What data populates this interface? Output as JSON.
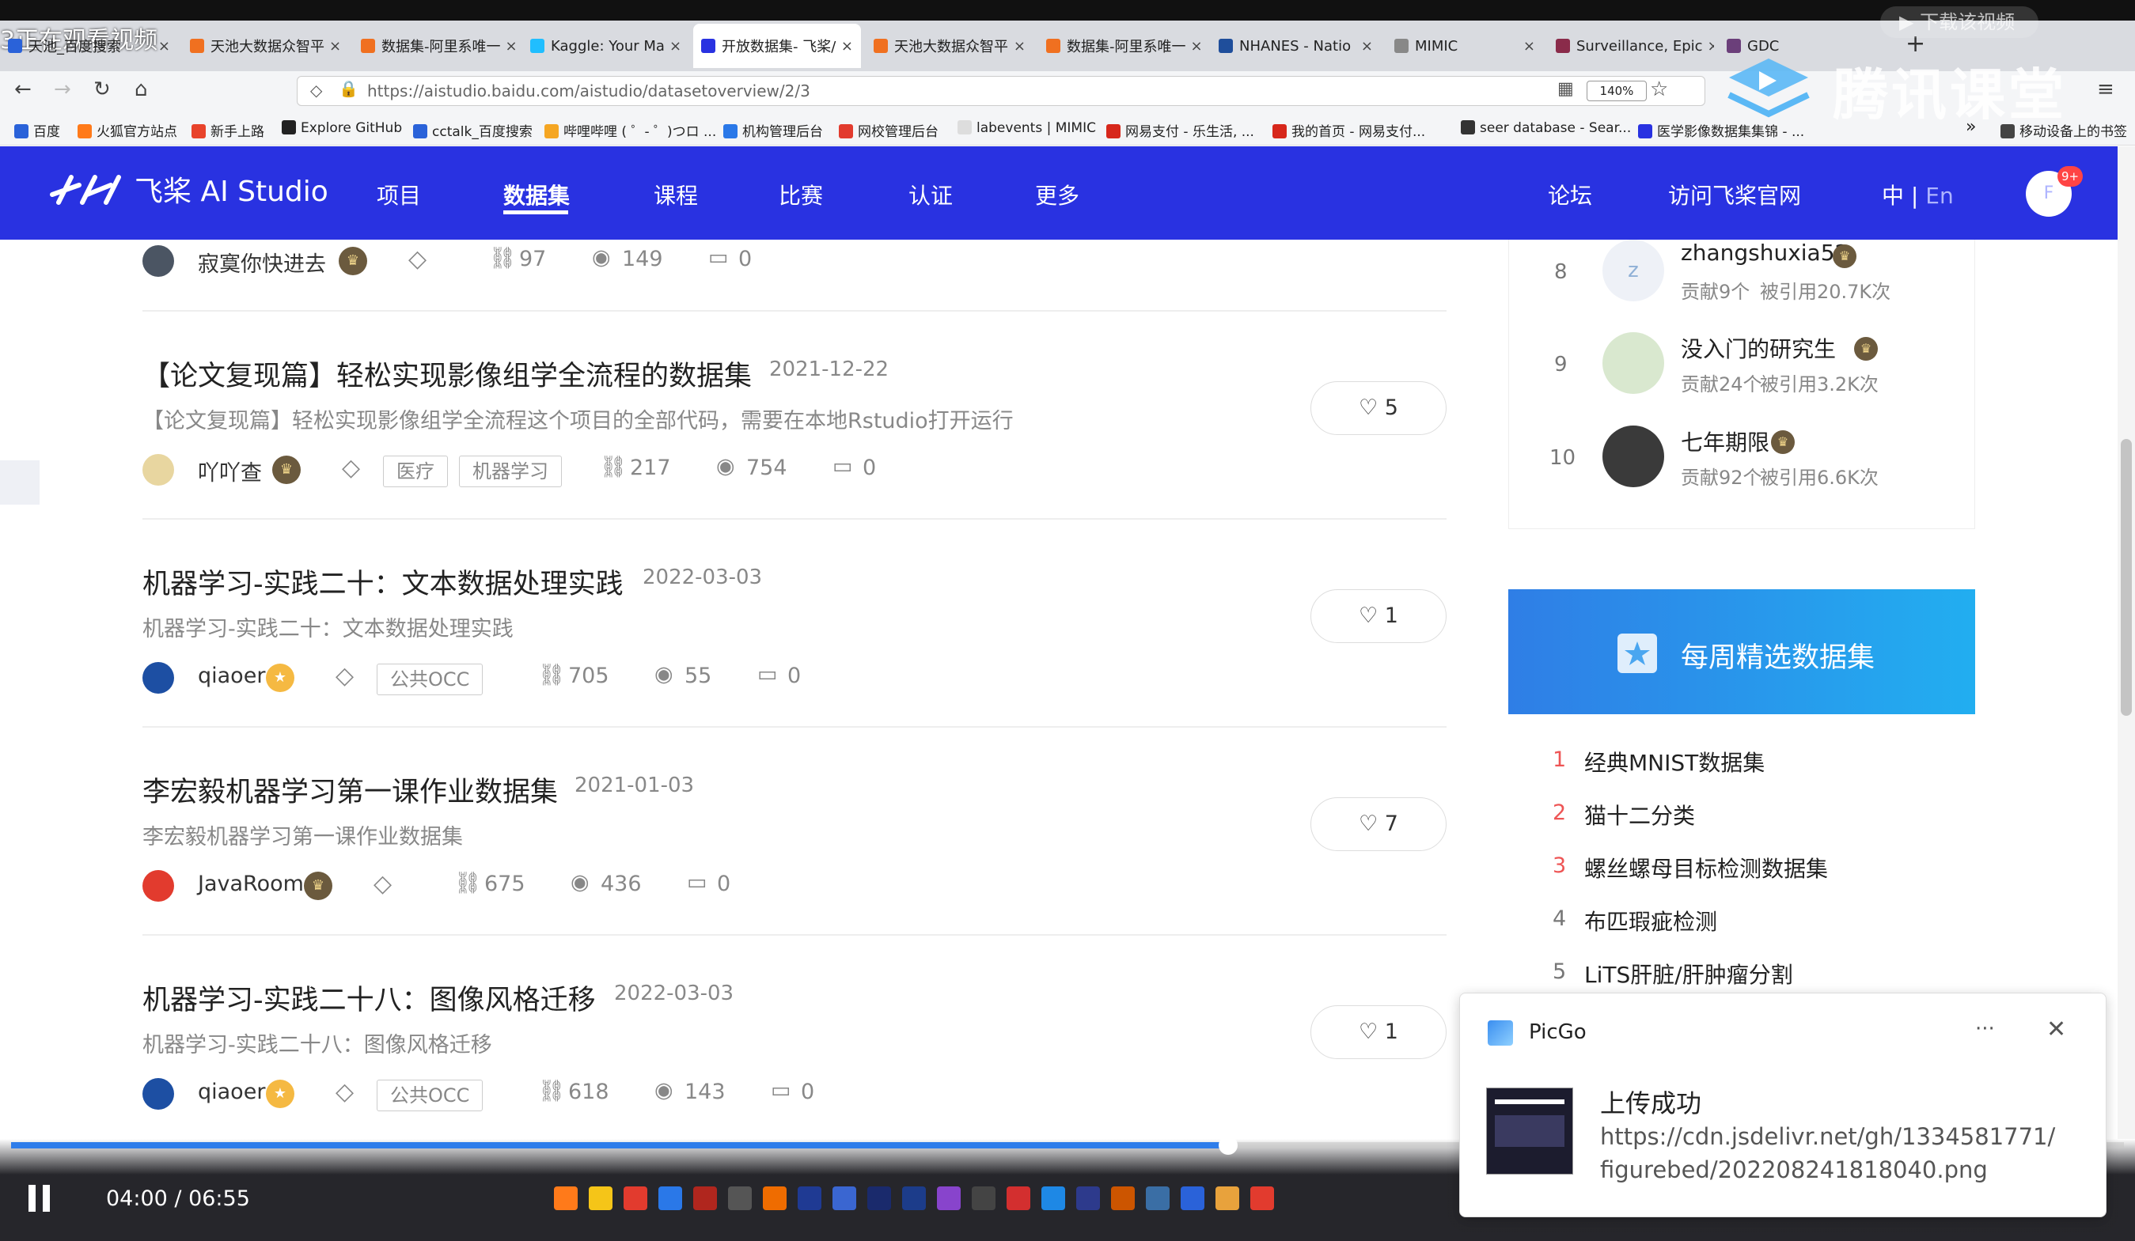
{
  "browser": {
    "tabs": [
      {
        "label": "天池_百度搜索",
        "color": "#2a62d9"
      },
      {
        "label": "天池大数据众智平",
        "color": "#f07020"
      },
      {
        "label": "数据集-阿里系唯一",
        "color": "#f07020"
      },
      {
        "label": "Kaggle: Your Ma",
        "color": "#20beff"
      },
      {
        "label": "开放数据集- 飞桨/",
        "color": "#2932e1"
      },
      {
        "label": "天池大数据众智平",
        "color": "#f07020"
      },
      {
        "label": "数据集-阿里系唯一",
        "color": "#f07020"
      },
      {
        "label": "NHANES - Natio",
        "color": "#1f4e9b"
      },
      {
        "label": "MIMIC",
        "color": "#888888"
      },
      {
        "label": "Surveillance, Epic",
        "color": "#8a2b4a"
      },
      {
        "label": "GDC",
        "color": "#6b3f7a"
      }
    ],
    "url": "https://aistudio.baidu.com/aistudio/datasetoverview/2/3",
    "zoom": "140%",
    "bookmarks": [
      {
        "label": "百度",
        "color": "#2a62d9"
      },
      {
        "label": "火狐官方站点",
        "color": "#ff7a1a"
      },
      {
        "label": "新手上路",
        "color": "#e8432b"
      },
      {
        "label": "Explore GitHub",
        "color": "#222222"
      },
      {
        "label": "cctalk_百度搜索",
        "color": "#2a62d9"
      },
      {
        "label": "哔哩哔哩 ( ゜- ゜)つロ ...",
        "color": "#f5a623"
      },
      {
        "label": "机构管理后台",
        "color": "#2a78e8"
      },
      {
        "label": "网校管理后台",
        "color": "#e23b2e"
      },
      {
        "label": "labevents | MIMIC",
        "color": "#dddddd"
      },
      {
        "label": "网易支付 - 乐生活, ...",
        "color": "#d7271b"
      },
      {
        "label": "我的首页 - 网易支付...",
        "color": "#d7271b"
      },
      {
        "label": "seer database - Sear...",
        "color": "#333333"
      },
      {
        "label": "医学影像数据集集锦 - ...",
        "color": "#2932e1"
      },
      {
        "label": "移动设备上的书签",
        "color": "#444444"
      }
    ],
    "overlay_text": "3正在观看视频"
  },
  "site": {
    "logo": "飞桨 AI Studio",
    "menu": [
      "项目",
      "数据集",
      "课程",
      "比赛",
      "认证",
      "更多"
    ],
    "right_links": [
      "论坛",
      "访问飞桨官网"
    ],
    "lang_zh": "中 |",
    "lang_en": "En",
    "avatar_letter": "F",
    "avatar_badge": "9+"
  },
  "datasets": [
    {
      "title": "",
      "date": "",
      "desc": "",
      "author": "寂寞你快进去",
      "tags": [],
      "links": "97",
      "views": "149",
      "comments": "0",
      "likes": ""
    },
    {
      "title": "【论文复现篇】轻松实现影像组学全流程的数据集",
      "date": "2021-12-22",
      "desc": "【论文复现篇】轻松实现影像组学全流程这个项目的全部代码，需要在本地Rstudio打开运行",
      "author": "吖吖查",
      "tags": [
        "医疗",
        "机器学习"
      ],
      "links": "217",
      "views": "754",
      "comments": "0",
      "likes": "5"
    },
    {
      "title": "机器学习-实践二十：文本数据处理实践",
      "date": "2022-03-03",
      "desc": "机器学习-实践二十：文本数据处理实践",
      "author": "qiaoer",
      "tags": [
        "公共OCC"
      ],
      "links": "705",
      "views": "55",
      "comments": "0",
      "likes": "1"
    },
    {
      "title": "李宏毅机器学习第一课作业数据集",
      "date": "2021-01-03",
      "desc": "李宏毅机器学习第一课作业数据集",
      "author": "JavaRoom",
      "tags": [],
      "links": "675",
      "views": "436",
      "comments": "0",
      "likes": "7"
    },
    {
      "title": "机器学习-实践二十八：图像风格迁移",
      "date": "2022-03-03",
      "desc": "机器学习-实践二十八：图像风格迁移",
      "author": "qiaoer",
      "tags": [
        "公共OCC"
      ],
      "links": "618",
      "views": "143",
      "comments": "0",
      "likes": "1"
    }
  ],
  "ranking": [
    {
      "rank": "8",
      "name": "zhangshuxia52",
      "contrib": "贡献9个",
      "cited": "被引用20.7K次",
      "avatar_letter": "z"
    },
    {
      "rank": "9",
      "name": "没入门的研究生",
      "contrib": "贡献24个",
      "cited": "被引用3.2K次"
    },
    {
      "rank": "10",
      "name": "七年期限",
      "contrib": "贡献92个",
      "cited": "被引用6.6K次"
    }
  ],
  "weekly": {
    "title": "每周精选数据集",
    "items": [
      {
        "n": "1",
        "label": "经典MNIST数据集"
      },
      {
        "n": "2",
        "label": "猫十二分类"
      },
      {
        "n": "3",
        "label": "螺丝螺母目标检测数据集"
      },
      {
        "n": "4",
        "label": "布匹瑕疵检测"
      },
      {
        "n": "5",
        "label": "LiTS肝脏/肝肿瘤分割"
      }
    ]
  },
  "toast": {
    "app": "PicGo",
    "more": "···",
    "message": "上传成功",
    "url_line1": "https://cdn.jsdelivr.net/gh/1334581771/",
    "url_line2": "figurebed/202208241818040.png"
  },
  "video": {
    "time": "04:00 / 06:55",
    "progress": 0.576,
    "watermark": "腾讯课堂",
    "download_btn": "下载该视频"
  }
}
